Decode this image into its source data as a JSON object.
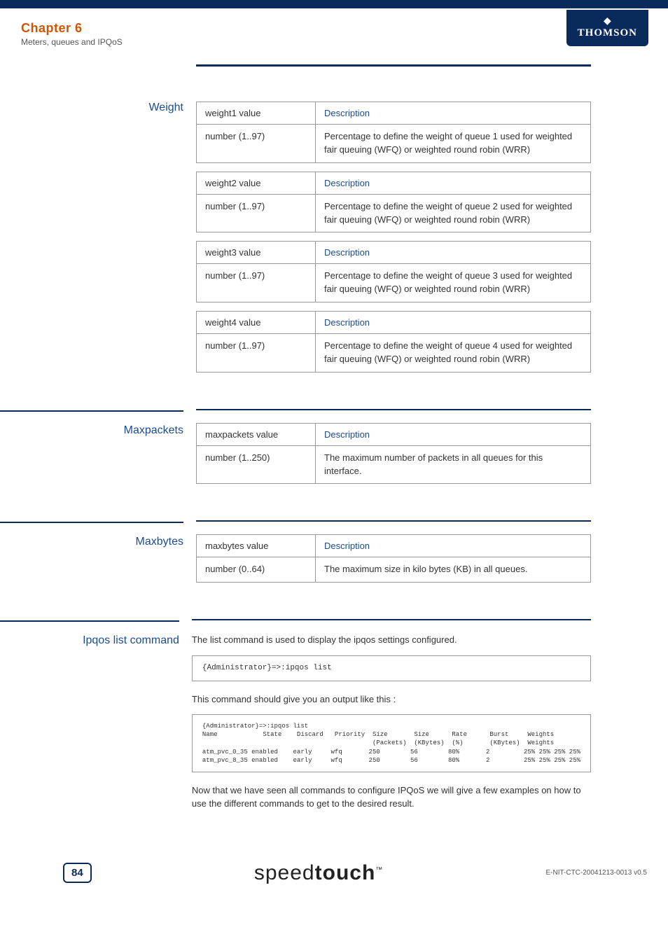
{
  "header": {
    "chapter": "Chapter 6",
    "subtitle": "Meters, queues and IPQoS",
    "brand": "THOMSON"
  },
  "sections": {
    "weight": {
      "title": "Weight",
      "tables": [
        {
          "h1": "weight1 value",
          "h2": "Description",
          "v1": "number (1..97)",
          "v2": "Percentage to define the weight of queue 1 used for weighted fair queuing (WFQ) or weighted round robin (WRR)"
        },
        {
          "h1": "weight2 value",
          "h2": "Description",
          "v1": "number (1..97)",
          "v2": "Percentage to define the weight of queue 2 used for weighted fair queuing (WFQ) or weighted round robin (WRR)"
        },
        {
          "h1": "weight3 value",
          "h2": "Description",
          "v1": "number (1..97)",
          "v2": "Percentage to define the weight of queue 3 used for weighted fair queuing (WFQ) or weighted round robin (WRR)"
        },
        {
          "h1": "weight4 value",
          "h2": "Description",
          "v1": "number (1..97)",
          "v2": "Percentage to define the weight of queue 4 used for weighted fair queuing (WFQ) or weighted round robin (WRR)"
        }
      ]
    },
    "maxpackets": {
      "title": "Maxpackets",
      "table": {
        "h1": "maxpackets value",
        "h2": "Description",
        "v1": "number (1..250)",
        "v2": "The maximum number of packets in all queues for this interface."
      }
    },
    "maxbytes": {
      "title": "Maxbytes",
      "table": {
        "h1": "maxbytes value",
        "h2": "Description",
        "v1": "number (0..64)",
        "v2": "The maximum size in kilo bytes (KB) in all queues."
      }
    },
    "ipqos": {
      "title": "Ipqos list command",
      "intro": "The list command is used to display the ipqos settings configured.",
      "code1": "{Administrator}=>:ipqos list",
      "after_code1": "This command should give you an output like this :",
      "code2": "{Administrator}=>:ipqos list\nName            State    Discard   Priority  Size       Size      Rate      Burst     Weights\n                                             (Packets)  (KBytes)  (%)       (KBytes)  Weights\natm_pvc_0_35 enabled    early     wfq       250        56        80%       2         25% 25% 25% 25%\natm_pvc_8_35 enabled    early     wfq       250        56        80%       2         25% 25% 25% 25%",
      "outro": "Now that we have seen all commands to configure IPQoS we will give a few examples on how to use the different commands to get to the desired result."
    }
  },
  "footer": {
    "page": "84",
    "brand_a": "speed",
    "brand_b": "touch",
    "docid": "E-NIT-CTC-20041213-0013 v0.5"
  }
}
